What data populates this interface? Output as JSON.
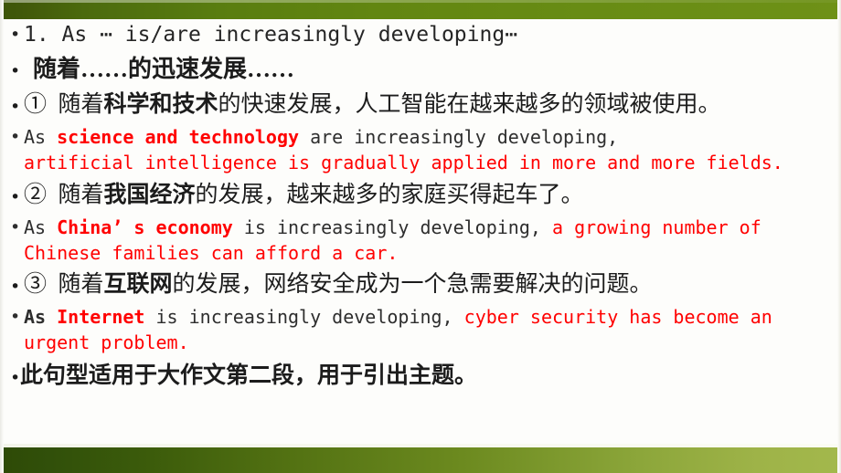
{
  "slide": {
    "theme": {
      "background": "#fdfdfb",
      "top_bar_gradient_start": "#3d5508",
      "top_bar_gradient_end": "#6e9117",
      "bottom_bar_gradient_start": "#2e4a06",
      "bottom_bar_gradient_end": "#a3b84c",
      "accent_red": "#ff0000",
      "body_text": "#2b2b2b"
    },
    "bullet_glyph": "•"
  },
  "lines": {
    "heading_en": "1. As ⋯ is/are increasingly developing⋯",
    "heading_cn": "随着……的迅速发展……",
    "item1_cn_marker": "①",
    "item1_cn_a": "随着",
    "item1_cn_bold": "科学和技术",
    "item1_cn_b": "的快速发展，人工智能在越来越多的领域被使用。",
    "item1_en_a": "As ",
    "item1_en_red_bold": "science and technology",
    "item1_en_b": " are increasingly developing,",
    "item1_en_red": "artificial intelligence is gradually applied in more and more fields.",
    "item2_cn_marker": "②",
    "item2_cn_a": "随着",
    "item2_cn_bold": "我国经济",
    "item2_cn_b": "的发展，越来越多的家庭买得起车了。",
    "item2_en_a": "As ",
    "item2_en_red_bold": "China’ s economy",
    "item2_en_b": " is increasingly developing, ",
    "item2_en_red": "a growing number of Chinese families can afford a car.",
    "item3_cn_marker": "③",
    "item3_cn_a": "随着",
    "item3_cn_bold": "互联网",
    "item3_cn_b": "的发展，网络安全成为一个急需要解决的问题。",
    "item3_en_a": "As ",
    "item3_en_red_bold": "Internet",
    "item3_en_b": " is increasingly developing, ",
    "item3_en_red": "cyber security has become an urgent problem.",
    "footer_note": "此句型适用于大作文第二段，用于引出主题。"
  }
}
